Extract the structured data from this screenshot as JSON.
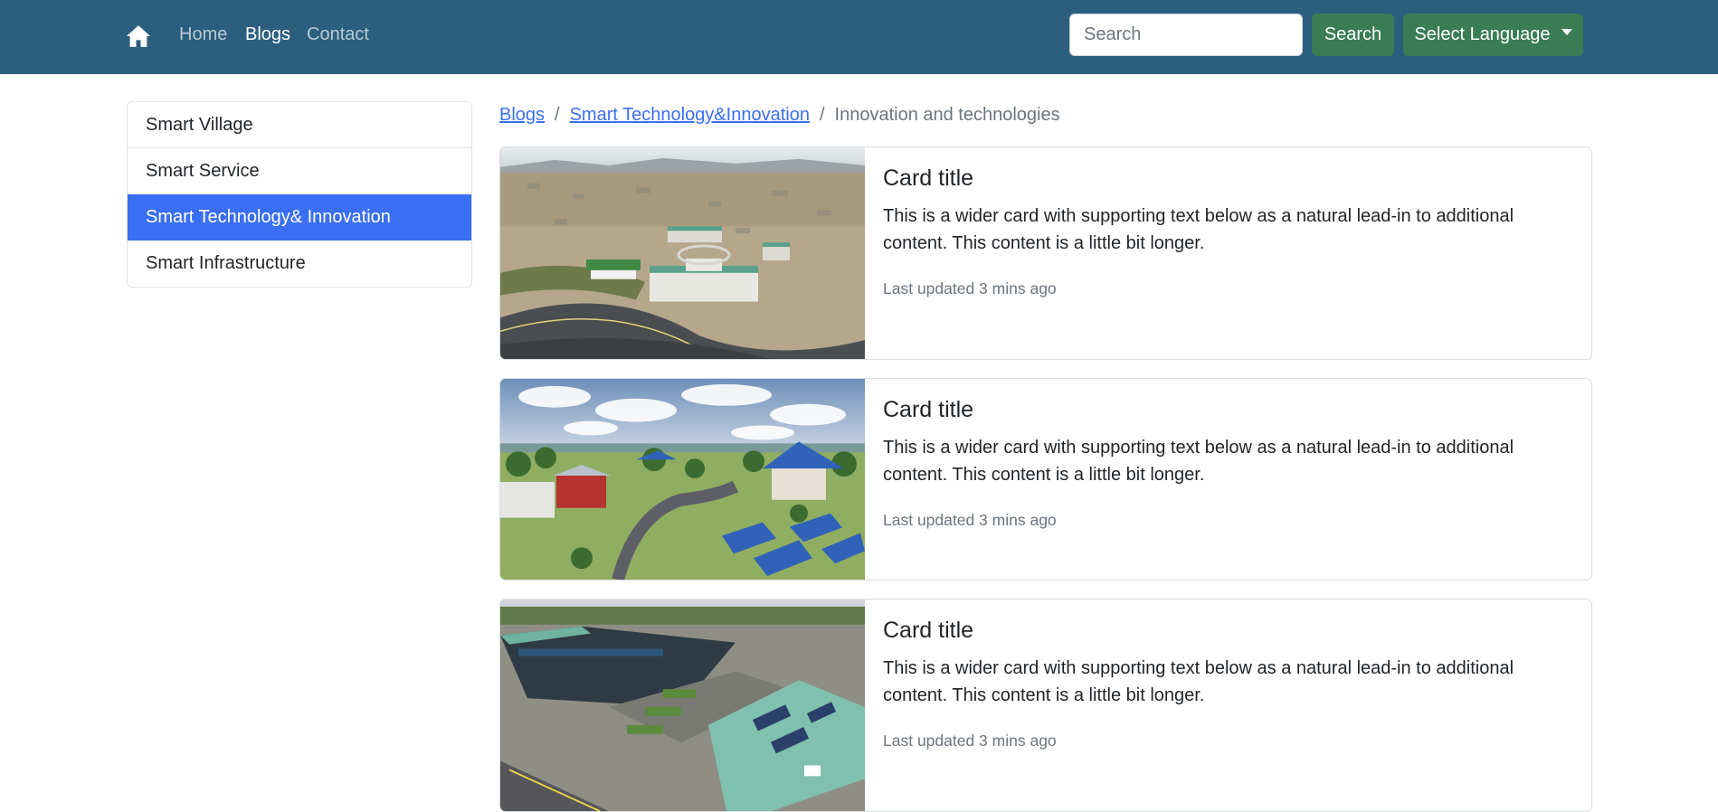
{
  "navbar": {
    "home_icon": "home-icon",
    "links": [
      "Home",
      "Blogs",
      "Contact"
    ],
    "active_link": "Blogs",
    "search": {
      "placeholder": "Search",
      "value": ""
    },
    "search_button": "Search",
    "language_button": "Select Language",
    "colors": {
      "background": "#2c5f7e",
      "button": "#3a7d55"
    }
  },
  "sidebar": {
    "items": [
      {
        "label": "Smart Village"
      },
      {
        "label": "Smart Service"
      },
      {
        "label": "Smart Technology& Innovation",
        "active": true
      },
      {
        "label": "Smart Infrastructure"
      }
    ],
    "active_color": "#3a6ff3"
  },
  "breadcrumb": {
    "items": [
      "Blogs",
      "Smart Technology&Innovation"
    ],
    "current": "Innovation and technologies",
    "separator": "/"
  },
  "cards": [
    {
      "title": "Card title",
      "text": "This is a wider card with supporting text below as a natural lead-in to additional content. This content is a little bit longer.",
      "updated": "Last updated 3 mins ago"
    },
    {
      "title": "Card title",
      "text": "This is a wider card with supporting text below as a natural lead-in to additional content. This content is a little bit longer.",
      "updated": "Last updated 3 mins ago"
    },
    {
      "title": "Card title",
      "text": "This is a wider card with supporting text below as a natural lead-in to additional content. This content is a little bit longer.",
      "updated": "Last updated 3 mins ago"
    }
  ]
}
